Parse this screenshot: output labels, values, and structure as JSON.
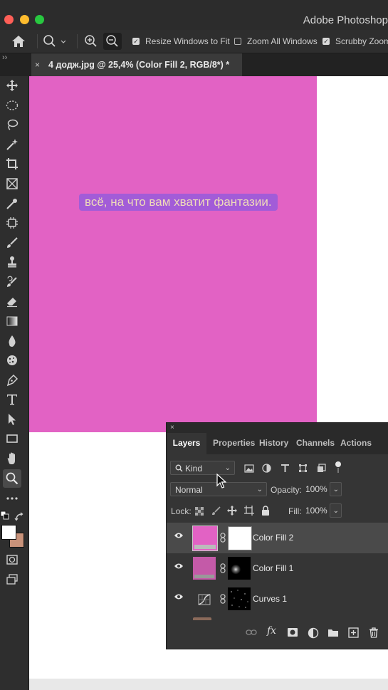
{
  "app": {
    "title": "Adobe Photoshop"
  },
  "window_controls": {
    "close_color": "#ff5f57",
    "minimize_color": "#febc2e",
    "zoom_color": "#28c840"
  },
  "options_bar": {
    "resize_windows_label": "Resize Windows to Fit",
    "resize_windows_checked": true,
    "zoom_all_label": "Zoom All Windows",
    "zoom_all_checked": false,
    "scrubby_zoom_label": "Scrubby Zoom",
    "scrubby_zoom_checked": true
  },
  "tabbar": {
    "collapse_glyph": "››"
  },
  "document": {
    "tab_title": "4 додж.jpg @ 25,4% (Color Fill 2, RGB/8*) *",
    "close_glyph": "×",
    "fill_color": "#e262c4",
    "caption": "всё, на что вам хватит фантазии."
  },
  "toolbar": {
    "tools": [
      "move-icon",
      "marquee-icon",
      "lasso-icon",
      "magic-wand-icon",
      "crop-icon",
      "frame-icon",
      "eyedropper-icon",
      "healing-icon",
      "brush-icon",
      "stamp-icon",
      "history-brush-icon",
      "eraser-icon",
      "gradient-icon",
      "blur-icon",
      "sponge-icon",
      "pen-icon",
      "type-icon",
      "path-select-icon",
      "rectangle-icon",
      "hand-icon",
      "zoom-icon",
      "more-icon"
    ],
    "active_tool": "zoom-icon",
    "foreground_color": "#ffffff",
    "background_color": "#c8927a"
  },
  "layers_panel": {
    "close_glyph": "×",
    "tabs": [
      "Layers",
      "Properties",
      "History",
      "Channels",
      "Actions"
    ],
    "active_tab": "Layers",
    "filter_label": "Kind",
    "blend_mode": "Normal",
    "opacity_label": "Opacity:",
    "opacity_value": "100%",
    "lock_label": "Lock:",
    "fill_label": "Fill:",
    "fill_value": "100%",
    "layers": [
      {
        "name": "Color Fill 2",
        "selected": true,
        "thumb_color": "#e262c4"
      },
      {
        "name": "Color Fill 1",
        "selected": false,
        "thumb_color": "#c45aa8"
      },
      {
        "name": "Curves 1",
        "selected": false,
        "thumb_color": "#353535"
      }
    ]
  }
}
